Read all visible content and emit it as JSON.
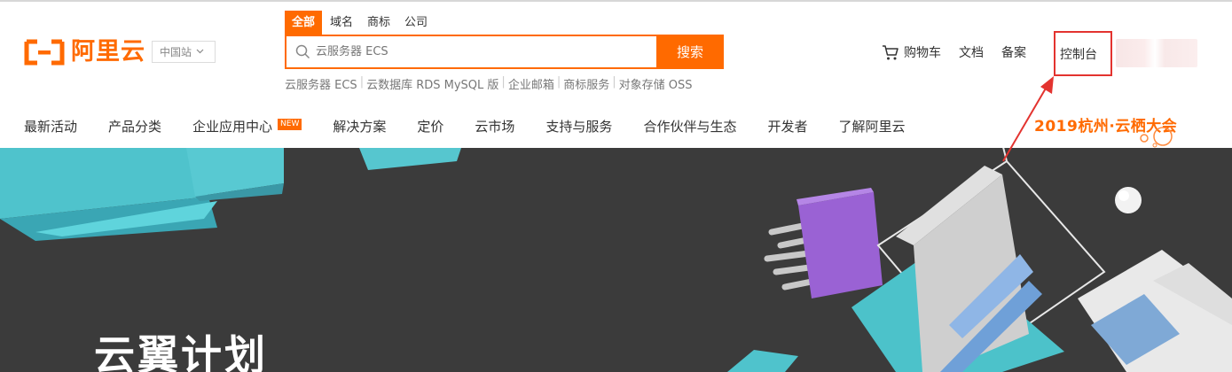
{
  "brand": {
    "name": "阿里云",
    "site": "中国站",
    "accent": "#ff6a00"
  },
  "search": {
    "tabs": [
      "全部",
      "域名",
      "商标",
      "公司"
    ],
    "placeholder": "云服务器 ECS",
    "button": "搜索",
    "hot": [
      "云服务器 ECS",
      "云数据库 RDS MySQL 版",
      "企业邮箱",
      "商标服务",
      "对象存储 OSS"
    ]
  },
  "header_links": {
    "cart": "购物车",
    "docs": "文档",
    "beian": "备案",
    "console": "控制台"
  },
  "nav": {
    "items": [
      "最新活动",
      "产品分类",
      "企业应用中心",
      "解决方案",
      "定价",
      "云市场",
      "支持与服务",
      "合作伙伴与生态",
      "开发者",
      "了解阿里云"
    ],
    "new_badge": "NEW",
    "event": "2019杭州·云栖大会"
  },
  "hero": {
    "title": "云翼计划"
  },
  "annotation": {
    "highlight_color": "#e3332f"
  },
  "icons": [
    "logo-icon",
    "chevron-down-icon",
    "search-icon",
    "cart-icon",
    "arrow-icon"
  ]
}
